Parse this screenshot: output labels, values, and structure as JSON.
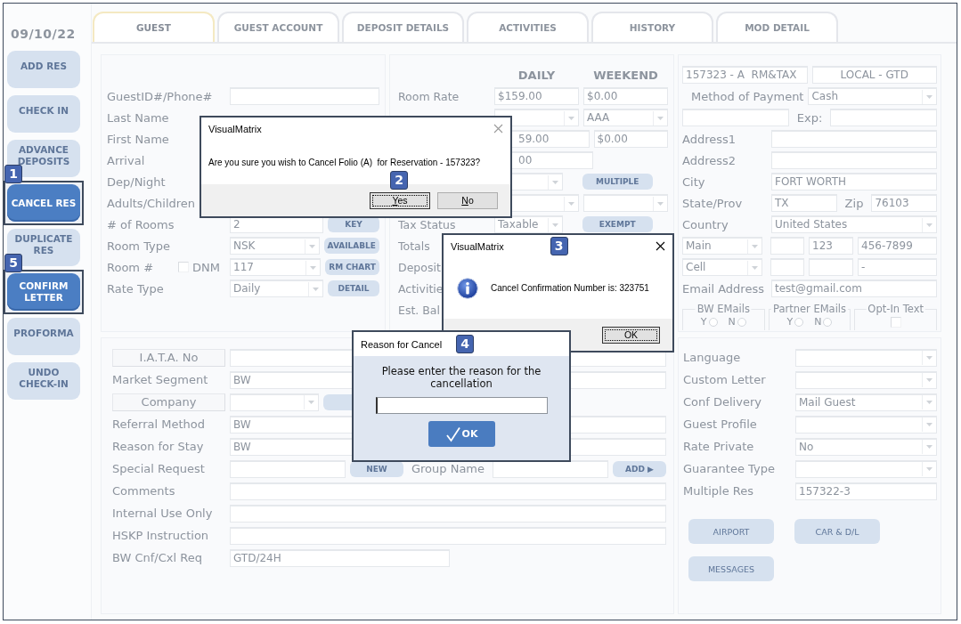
{
  "sidebar": {
    "date": "09/10/22",
    "items": [
      {
        "label": "ADD RES",
        "highlighted": false
      },
      {
        "label": "CHECK IN",
        "highlighted": false
      },
      {
        "label": "ADVANCE DEPOSITS",
        "highlighted": false
      },
      {
        "label": "CANCEL RES",
        "highlighted": true,
        "callout": "1"
      },
      {
        "label": "DUPLICATE RES",
        "highlighted": false
      },
      {
        "label": "CONFIRM LETTER",
        "highlighted": true,
        "callout": "5"
      },
      {
        "label": "PROFORMA",
        "highlighted": false
      },
      {
        "label": "UNDO CHECK-IN",
        "highlighted": false
      }
    ]
  },
  "tabs": [
    {
      "label": "GUEST",
      "selected": true
    },
    {
      "label": "GUEST ACCOUNT",
      "selected": false
    },
    {
      "label": "DEPOSIT DETAILS",
      "selected": false
    },
    {
      "label": "ACTIVITIES",
      "selected": false
    },
    {
      "label": "HISTORY",
      "selected": false
    },
    {
      "label": "MOD DETAIL",
      "selected": false
    }
  ],
  "panels": [
    {
      "rows": [
        [
          {
            "kind": "label",
            "text": "GuestID#/Phone#"
          },
          {
            "kind": "input"
          }
        ],
        [
          {
            "kind": "label",
            "text": "Last Name"
          }
        ],
        [
          {
            "kind": "label",
            "text": "First Name"
          }
        ],
        [
          {
            "kind": "label",
            "text": "Arrival"
          }
        ],
        [
          {
            "kind": "label",
            "text": "Dep/Night"
          }
        ],
        [
          {
            "kind": "label",
            "text": "Adults/Children"
          }
        ],
        [
          {
            "kind": "label",
            "text": "# of Rooms"
          },
          {
            "kind": "input",
            "value": "2"
          },
          {
            "kind": "button",
            "text": "KEY"
          }
        ],
        [
          {
            "kind": "label",
            "text": "Room Type"
          },
          {
            "kind": "dropdown",
            "value": "NSK"
          },
          {
            "kind": "button",
            "text": "AVAILABLE"
          }
        ],
        [
          {
            "kind": "label",
            "text": "Room #",
            "check": {
              "text": "DNM",
              "checked": false
            }
          },
          {
            "kind": "dropdown",
            "value": "117"
          },
          {
            "kind": "button",
            "text": "RM CHART"
          }
        ],
        [
          {
            "kind": "label",
            "text": "Rate Type"
          },
          {
            "kind": "dropdown",
            "value": "Daily"
          },
          {
            "kind": "button",
            "text": "DETAIL"
          }
        ]
      ]
    },
    {
      "rows": [
        [
          {
            "kind": "blank"
          },
          {
            "kind": "heading",
            "text": "DAILY"
          },
          {
            "kind": "heading",
            "text": "WEEKEND"
          }
        ],
        [
          {
            "kind": "label",
            "text": "Room Rate"
          },
          {
            "kind": "input",
            "value": "$159.00"
          },
          {
            "kind": "input",
            "value": "$0.00"
          }
        ],
        [
          {
            "kind": "blank"
          },
          {
            "kind": "dropdown"
          },
          {
            "kind": "dropdown",
            "value": "AAA"
          }
        ],
        [
          {
            "kind": "blank"
          },
          {
            "kind": "input",
            "value": "59.00",
            "partial": true
          },
          {
            "kind": "input",
            "value": "$0.00"
          }
        ],
        [
          {
            "kind": "blank"
          },
          {
            "kind": "input",
            "value": "00",
            "partial": true
          },
          {
            "kind": "gap"
          }
        ],
        [
          {
            "kind": "blank"
          },
          {
            "kind": "dropdown"
          },
          {
            "kind": "button",
            "text": "MULTIPLE"
          }
        ],
        [
          {
            "kind": "blank"
          },
          {
            "kind": "dropdown"
          },
          {
            "kind": "dropdown"
          }
        ],
        [
          {
            "kind": "label",
            "text": "Tax Status"
          },
          {
            "kind": "dropdown",
            "value": "Taxable"
          },
          {
            "kind": "button",
            "text": "EXEMPT"
          }
        ],
        [
          {
            "kind": "label",
            "text": "Totals"
          }
        ],
        [
          {
            "kind": "label",
            "text": "Deposit"
          }
        ],
        [
          {
            "kind": "label",
            "text": "Activitie"
          }
        ],
        [
          {
            "kind": "label",
            "text": "Est. Bal"
          }
        ]
      ]
    },
    {
      "summary": [
        {
          "value": "157323 - A  RM&TAX"
        },
        {
          "value": "LOCAL - GTD"
        }
      ],
      "rows": [
        [
          {
            "kind": "label",
            "text": "Method of Payment"
          },
          {
            "kind": "dropdown",
            "value": "Cash"
          }
        ],
        [
          {
            "kind": "input"
          },
          {
            "kind": "inline-label",
            "text": "Exp:"
          },
          {
            "kind": "input"
          }
        ],
        [
          {
            "kind": "label",
            "text": "Address1"
          },
          {
            "kind": "input"
          }
        ],
        [
          {
            "kind": "label",
            "text": "Address2"
          },
          {
            "kind": "input"
          }
        ],
        [
          {
            "kind": "label",
            "text": "City"
          },
          {
            "kind": "input",
            "value": "FORT WORTH"
          }
        ],
        [
          {
            "kind": "label",
            "text": "State/Prov"
          },
          {
            "kind": "input",
            "value": "TX"
          },
          {
            "kind": "inline-label",
            "text": "Zip"
          },
          {
            "kind": "input",
            "value": "76103"
          }
        ],
        [
          {
            "kind": "label",
            "text": "Country"
          },
          {
            "kind": "dropdown",
            "value": "United States"
          }
        ]
      ],
      "phones": [
        {
          "type": "Main",
          "fields": [
            {
              "kind": "input"
            },
            {
              "kind": "input",
              "value": "123"
            },
            {
              "kind": "input",
              "value": "456-7899"
            }
          ]
        },
        {
          "type": "Cell",
          "fields": [
            {
              "kind": "input"
            },
            {
              "kind": "input"
            },
            {
              "kind": "input",
              "value": "-"
            }
          ]
        }
      ],
      "rows_end": [
        [
          {
            "kind": "label",
            "text": "Email Address"
          },
          {
            "kind": "input",
            "value": "test@gmail.com"
          }
        ],
        [
          {
            "kind": "radiogroup",
            "text": "BW EMails",
            "options": [
              {
                "text": "Y",
                "selected": false
              },
              {
                "text": "N",
                "selected": false
              }
            ]
          },
          {
            "kind": "radiogroup",
            "text": "Partner EMails",
            "options": [
              {
                "text": "Y",
                "selected": false
              },
              {
                "text": "N",
                "selected": false
              }
            ]
          },
          {
            "kind": "checkgroup",
            "text": "Opt-In Text",
            "checked": false
          }
        ]
      ]
    },
    {
      "rows": [
        [
          {
            "kind": "label-button",
            "text": "I.A.T.A. No"
          },
          {
            "kind": "input"
          }
        ],
        [
          {
            "kind": "label",
            "text": "Market Segment"
          },
          {
            "kind": "input",
            "value": "BW"
          }
        ],
        [
          {
            "kind": "label-button",
            "text": "Company"
          },
          {
            "kind": "dropdown"
          },
          {
            "kind": "button"
          },
          {
            "kind": "gap"
          }
        ],
        [
          {
            "kind": "label",
            "text": "Referral Method"
          },
          {
            "kind": "input",
            "value": "BW"
          }
        ],
        [
          {
            "kind": "label",
            "text": "Reason for Stay"
          },
          {
            "kind": "input",
            "value": "BW"
          }
        ],
        [
          {
            "kind": "label",
            "text": "Special Request"
          },
          {
            "kind": "input"
          },
          {
            "kind": "button",
            "text": "NEW"
          },
          {
            "kind": "inline-label",
            "text": "Group Name"
          },
          {
            "kind": "input"
          },
          {
            "kind": "button",
            "text": "ADD ▶"
          }
        ],
        [
          {
            "kind": "label",
            "text": "Comments"
          },
          {
            "kind": "input"
          }
        ],
        [
          {
            "kind": "label",
            "text": "Internal Use Only"
          },
          {
            "kind": "input"
          }
        ],
        [
          {
            "kind": "label",
            "text": "HSKP Instruction"
          },
          {
            "kind": "input"
          }
        ],
        [
          {
            "kind": "label",
            "text": "BW Cnf/Cxl Req"
          },
          {
            "kind": "input",
            "value": "GTD/24H"
          },
          {
            "kind": "gap"
          }
        ]
      ]
    },
    {
      "rows": [
        [
          {
            "kind": "label",
            "text": "Language"
          },
          {
            "kind": "dropdown"
          }
        ],
        [
          {
            "kind": "label",
            "text": "Custom Letter"
          },
          {
            "kind": "dropdown"
          }
        ],
        [
          {
            "kind": "label",
            "text": "Conf Delivery"
          },
          {
            "kind": "dropdown",
            "value": "Mail Guest"
          }
        ],
        [
          {
            "kind": "label",
            "text": "Guest Profile"
          },
          {
            "kind": "dropdown"
          }
        ],
        [
          {
            "kind": "label",
            "text": "Rate Private"
          },
          {
            "kind": "dropdown",
            "value": "No"
          }
        ],
        [
          {
            "kind": "label",
            "text": "Guarantee Type"
          },
          {
            "kind": "dropdown"
          }
        ],
        [
          {
            "kind": "label",
            "text": "Multiple Res"
          },
          {
            "kind": "input",
            "value": "157322-3"
          }
        ],
        [
          {
            "kind": "bigbutton",
            "text": "AIRPORT"
          },
          {
            "kind": "bigbutton",
            "text": "CAR & D/L"
          }
        ],
        [
          {
            "kind": "bigbutton",
            "text": "MESSAGES"
          }
        ]
      ]
    }
  ],
  "dialogs": [
    {
      "kind": "confirm",
      "title": "VisualMatrix",
      "closable": true,
      "message": "Are you sure you wish to Cancel Folio (A)  for Reservation - 157323?",
      "buttons": [
        {
          "text": "Yes",
          "focused": true,
          "mnemonic": true,
          "callout": "2"
        },
        {
          "text": "No",
          "focused": false,
          "mnemonic": true
        }
      ]
    },
    {
      "kind": "info",
      "title": "VisualMatrix",
      "callout": "3",
      "closable": true,
      "message": "Cancel Confirmation Number is: 323751",
      "buttons": [
        {
          "text": "OK",
          "focused": true,
          "mnemonic": false
        }
      ]
    },
    {
      "kind": "prompt",
      "title": "Reason for Cancel",
      "callout": "4",
      "closable": false,
      "message": "Please enter the reason for the cancellation",
      "buttons": [
        {
          "text": "OK",
          "focused": false,
          "mnemonic": false
        }
      ]
    }
  ]
}
